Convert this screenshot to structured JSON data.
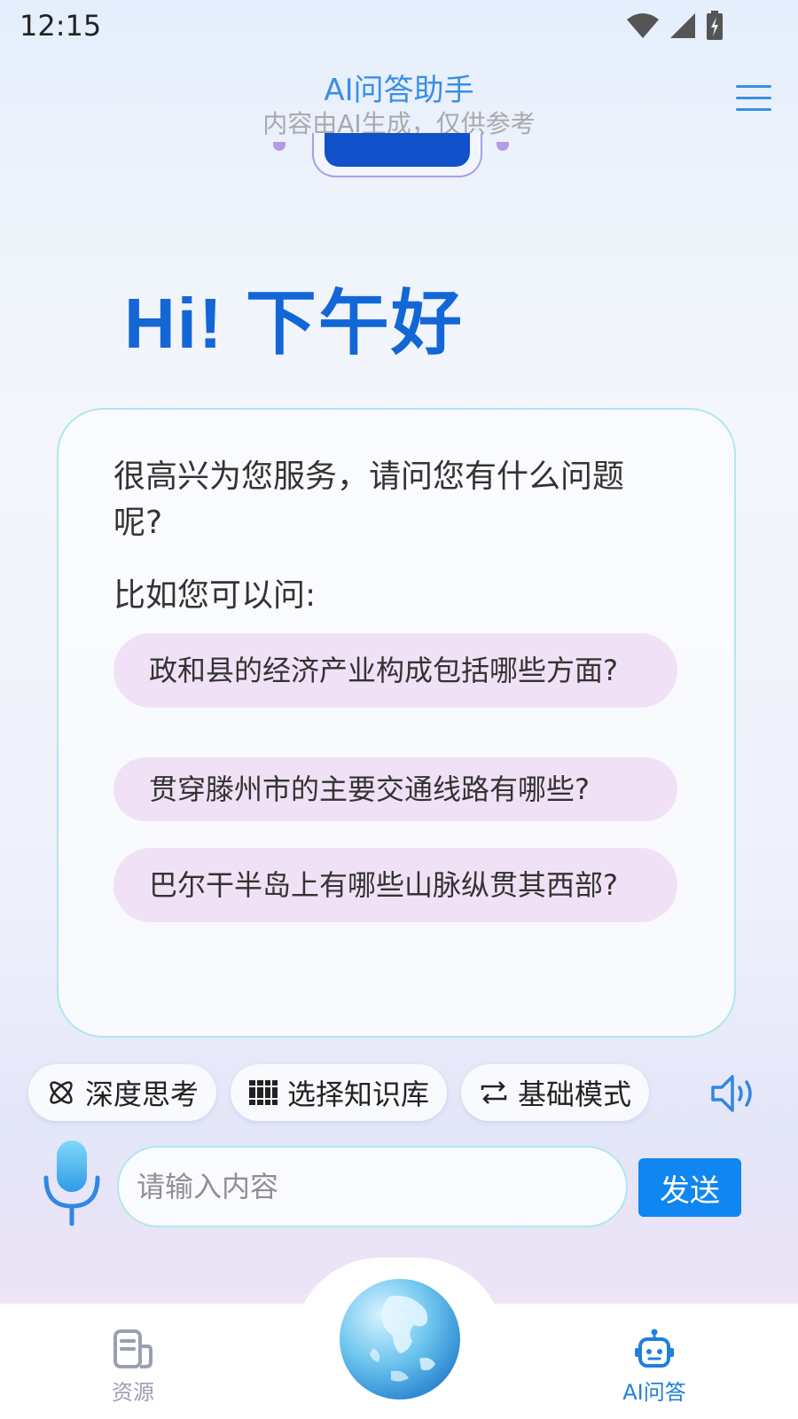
{
  "status_bar": {
    "time": "12:15"
  },
  "header": {
    "title": "AI问答助手",
    "subtitle": "内容由AI生成，仅供参考"
  },
  "greeting": "Hi! 下午好",
  "card": {
    "welcome": "很高兴为您服务，请问您有什么问题呢?",
    "example_label": "比如您可以问:",
    "suggestions": [
      "政和县的经济产业构成包括哪些方面?",
      "贯穿滕州市的主要交通线路有哪些?",
      "巴尔干半岛上有哪些山脉纵贯其西部?"
    ]
  },
  "tools": {
    "deep_think": "深度思考",
    "knowledge_base": "选择知识库",
    "basic_mode": "基础模式"
  },
  "input": {
    "placeholder": "请输入内容",
    "send": "发送"
  },
  "nav": {
    "resources": "资源",
    "ai_qa": "AI问答"
  },
  "colors": {
    "accent": "#0f86f0",
    "brand_blue": "#1366d6",
    "chip_pink": "#f1e1f6",
    "card_border": "#aee8ec",
    "muted": "#9aa0b0"
  }
}
